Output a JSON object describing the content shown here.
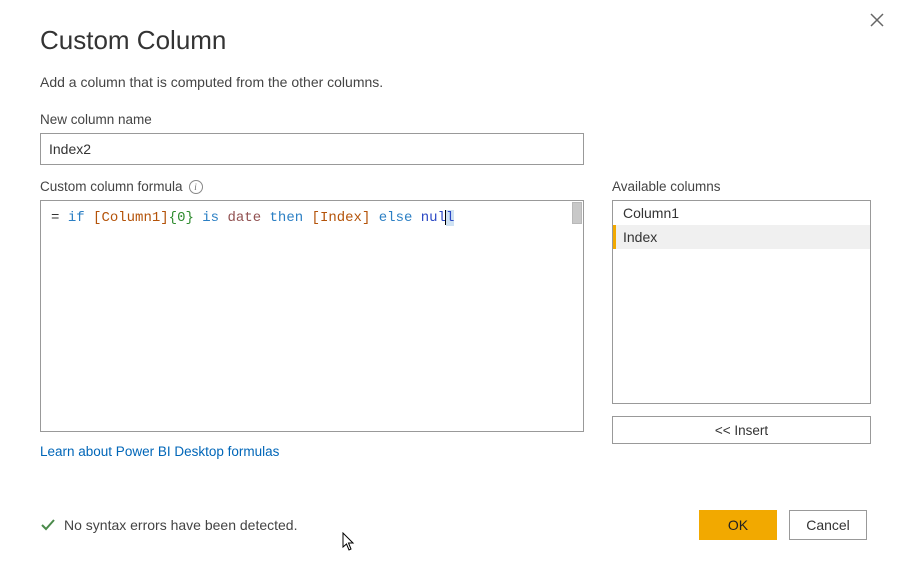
{
  "title": "Custom Column",
  "subtitle": "Add a column that is computed from the other columns.",
  "labels": {
    "new_column_name": "New column name",
    "formula": "Custom column formula",
    "available_columns": "Available columns"
  },
  "new_column_name_value": "Index2",
  "formula_tokens": {
    "eq": "= ",
    "if": "if",
    "col1_open": "[",
    "col1_name": "Column1",
    "col1_close": "]",
    "idx_open": "{",
    "idx_val": "0",
    "idx_close": "}",
    "is": "is",
    "date": "date",
    "then": "then",
    "idxcol_open": "[",
    "idxcol_name": "Index",
    "idxcol_close": "]",
    "else": "else",
    "null_a": "nul",
    "null_b": "l"
  },
  "available_columns": [
    {
      "name": "Column1",
      "selected": false
    },
    {
      "name": "Index",
      "selected": true
    }
  ],
  "insert_label": "<< Insert",
  "learn_link": "Learn about Power BI Desktop formulas",
  "status_text": "No syntax errors have been detected.",
  "buttons": {
    "ok": "OK",
    "cancel": "Cancel"
  }
}
